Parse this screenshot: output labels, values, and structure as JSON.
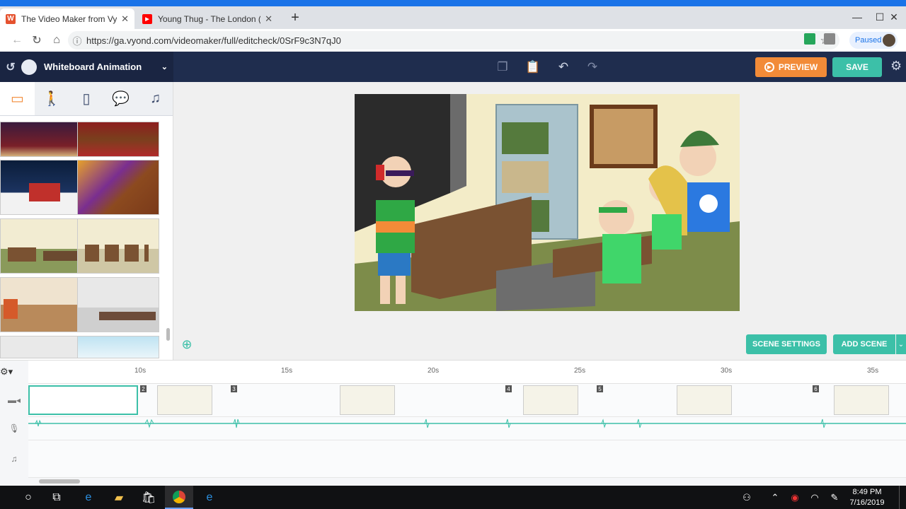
{
  "browser": {
    "tabs": [
      {
        "title": "The Video Maker from Vyond - M",
        "favicon": "W",
        "favicon_color": "#e5522f",
        "active": true
      },
      {
        "title": "Young Thug - The London (ft. J. C",
        "favicon": "▶",
        "favicon_color": "#ff0000",
        "active": false
      }
    ],
    "new_tab": "+",
    "url": "https://ga.vyond.com/videomaker/full/editcheck/0SrF9c3N7qJ0",
    "profile_status": "Paused"
  },
  "app": {
    "template_name": "Whiteboard Animation",
    "preview_label": "PREVIEW",
    "save_label": "SAVE",
    "scene_settings_label": "SCENE SETTINGS",
    "add_scene_label": "ADD SCENE",
    "accent_color": "#3cc0a8",
    "preview_color": "#f28b38",
    "header_color": "#1f2d4e"
  },
  "left_panel": {
    "categories": [
      "image-icon",
      "character-icon",
      "device-icon",
      "chat-bubble-icon",
      "music-note-icon"
    ],
    "thumbnails": [
      "holiday-dinner-scene",
      "church-pews-scene",
      "snowy-church-scene",
      "stained-glass-pews-scene",
      "classroom-scene-1",
      "classroom-scene-2",
      "restaurant-scene",
      "office-meeting-scene",
      "hallway-scene",
      "window-office-scene"
    ]
  },
  "timeline": {
    "ticks": [
      "10s",
      "15s",
      "20s",
      "25s",
      "30s",
      "35s"
    ],
    "scenes": [
      "2",
      "3",
      "4",
      "5",
      "6"
    ]
  },
  "taskbar": {
    "time": "8:49 PM",
    "date": "7/16/2019"
  }
}
